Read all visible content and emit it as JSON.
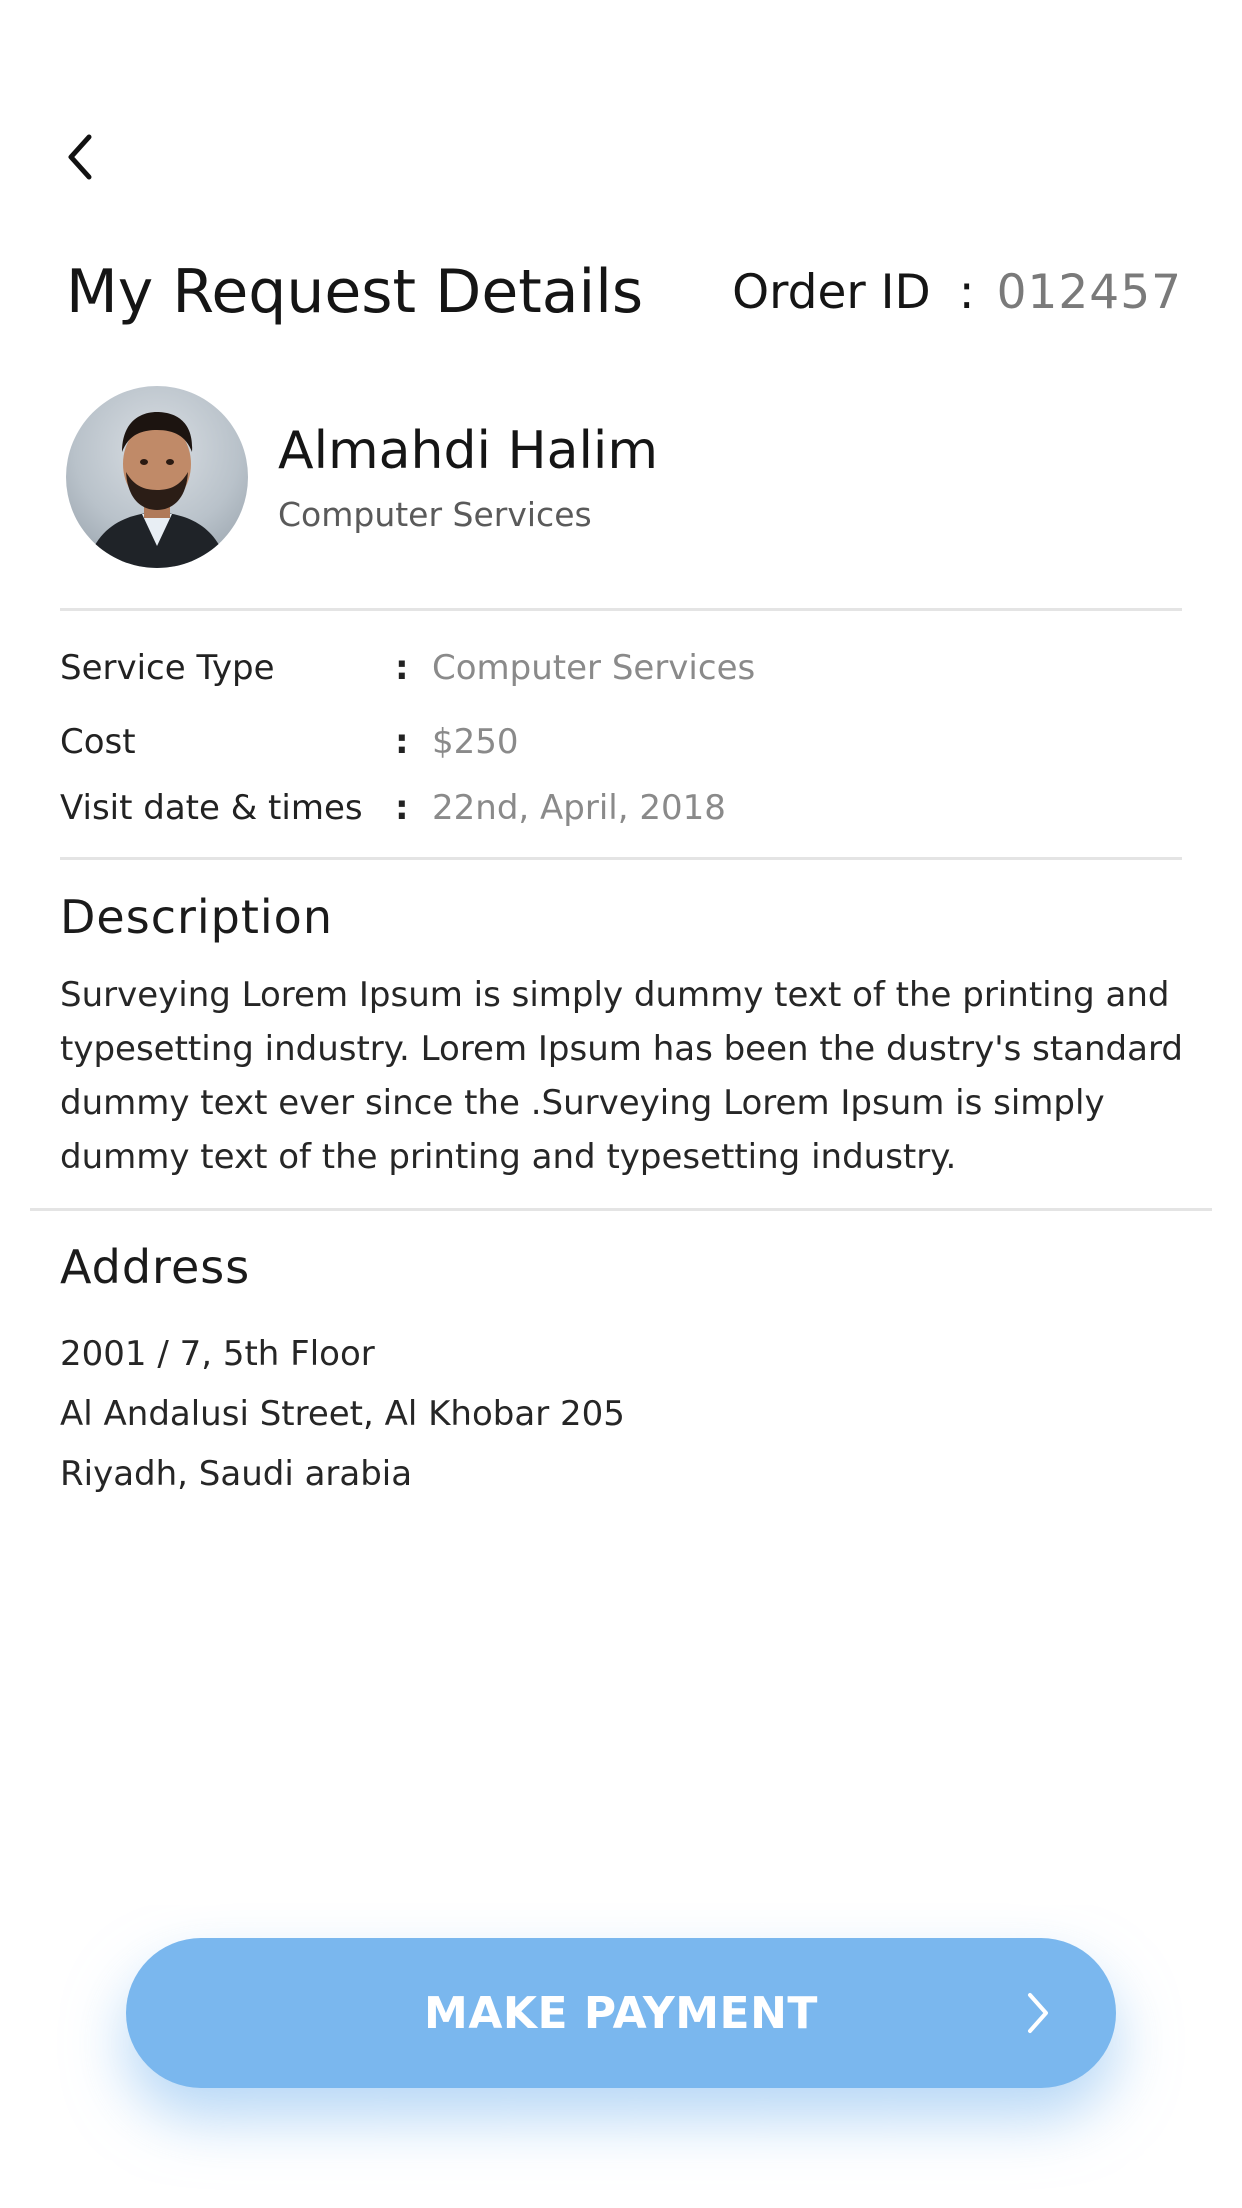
{
  "header": {
    "back_icon": "chevron-left-icon",
    "title": "My Request Details",
    "order_label": "Order ID",
    "order_colon": ":",
    "order_id": "012457"
  },
  "profile": {
    "name": "Almahdi Halim",
    "subtitle": "Computer Services"
  },
  "details": [
    {
      "label": "Service Type",
      "colon": ":",
      "value": "Computer Services"
    },
    {
      "label": "Cost",
      "colon": ":",
      "value": "$250"
    },
    {
      "label": "Visit date & times",
      "colon": ":",
      "value": "22nd, April, 2018"
    }
  ],
  "description": {
    "title": "Description",
    "text": "Surveying Lorem Ipsum is simply dummy text of the printing and typesetting industry. Lorem Ipsum has been the dustry's standard dummy text ever since the .Surveying Lorem Ipsum is simply dummy text of the printing and typesetting industry."
  },
  "address": {
    "title": "Address",
    "lines": [
      "2001 / 7, 5th Floor",
      "Al Andalusi Street, Al Khobar 205",
      "Riyadh, Saudi arabia"
    ]
  },
  "payment_button": {
    "label": "MAKE PAYMENT",
    "icon": "chevron-right-icon",
    "color": "#7ab7ee"
  }
}
